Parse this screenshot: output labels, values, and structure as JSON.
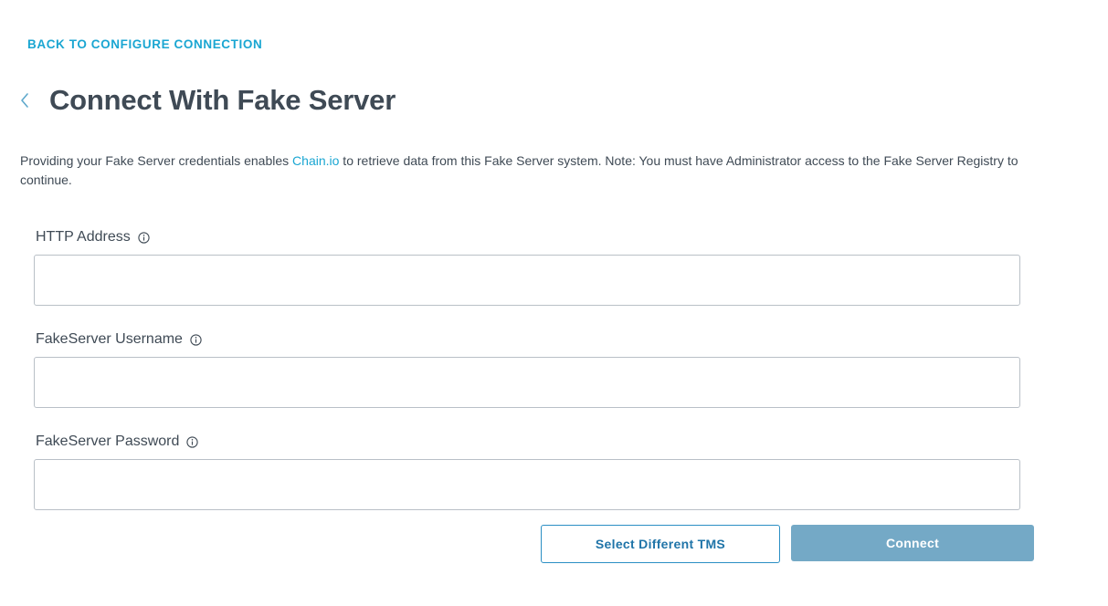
{
  "header": {
    "back_link": "BACK TO CONFIGURE CONNECTION",
    "back_icon": "chevron-left-icon",
    "title": "Connect With Fake Server"
  },
  "description": {
    "before_link": "Providing your Fake Server credentials enables ",
    "link": "Chain.io",
    "after_link": " to retrieve data from this Fake Server system. Note: You must have Administrator access to the Fake Server Registry to continue."
  },
  "form": {
    "http_address": {
      "label": "HTTP Address",
      "value": "",
      "icon": "info-icon"
    },
    "username": {
      "label": "FakeServer Username",
      "value": "",
      "icon": "info-icon"
    },
    "password": {
      "label": "FakeServer Password",
      "value": "",
      "icon": "info-icon"
    }
  },
  "actions": {
    "select_tms": "Select Different TMS",
    "connect": "Connect"
  },
  "colors": {
    "accent": "#1aa6d2",
    "text": "#3f4a55",
    "primary_button": "#74a9c6",
    "secondary_border": "#2b8fc4"
  }
}
